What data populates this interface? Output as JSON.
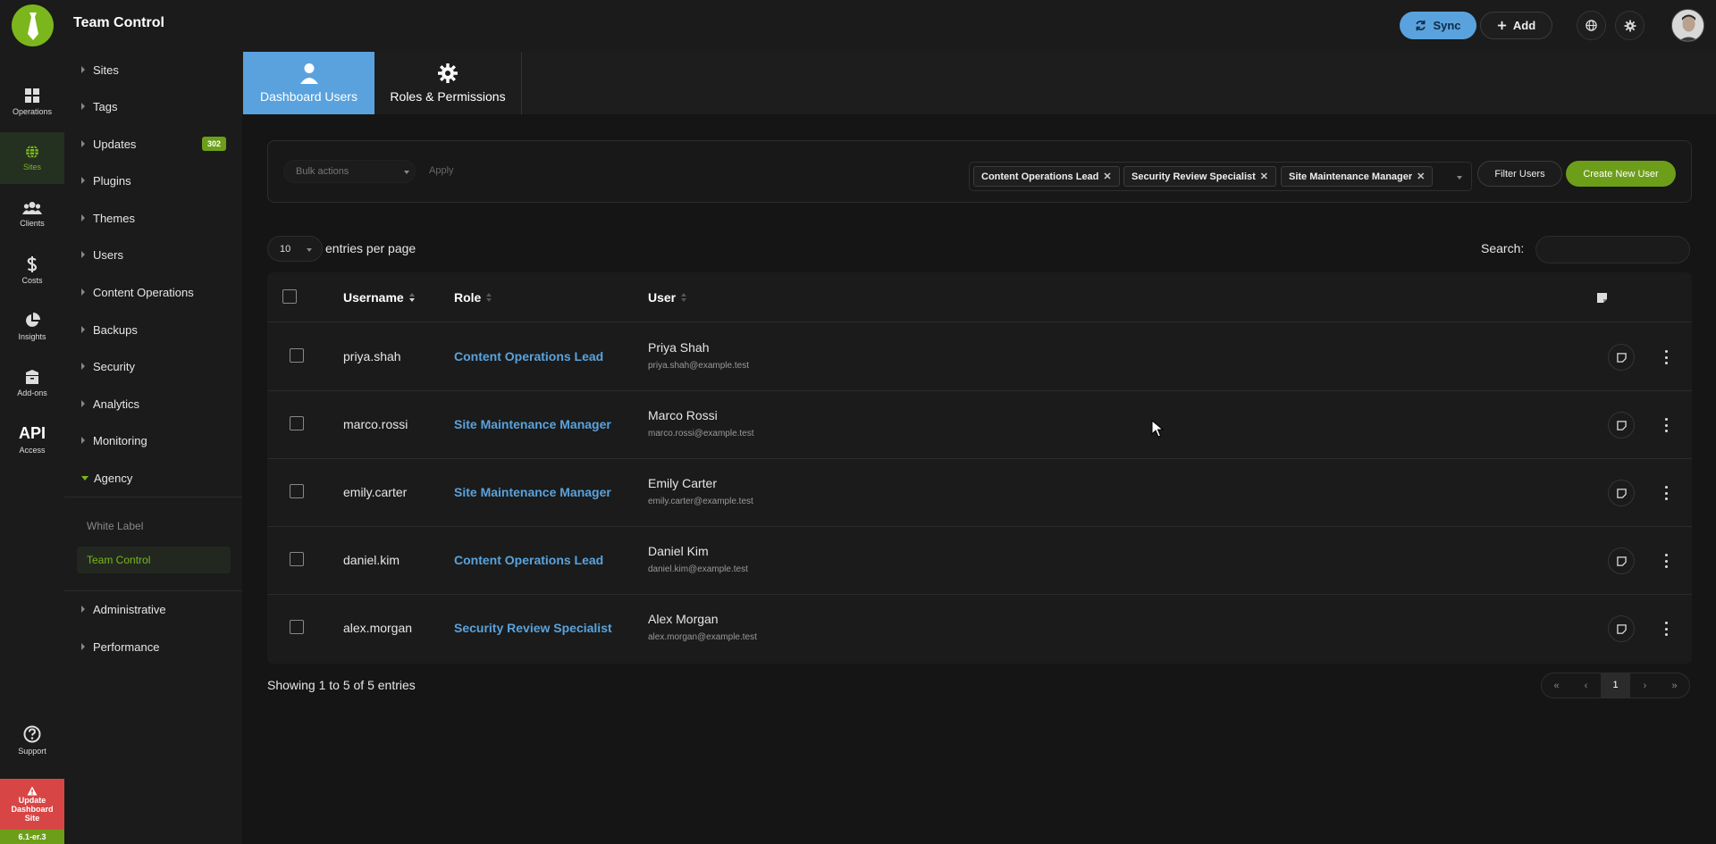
{
  "app": {
    "title": "Team Control"
  },
  "topbar": {
    "sync_label": "Sync",
    "add_label": "Add"
  },
  "rail": {
    "items": [
      {
        "label": "Operations",
        "icon": "grid-icon"
      },
      {
        "label": "Sites",
        "icon": "globe-icon"
      },
      {
        "label": "Clients",
        "icon": "users-icon"
      },
      {
        "label": "Costs",
        "icon": "dollar-icon"
      },
      {
        "label": "Insights",
        "icon": "pie-chart-icon"
      },
      {
        "label": "Add-ons",
        "icon": "box-icon"
      },
      {
        "label": "Access",
        "icon_text": "API"
      },
      {
        "label": "Support",
        "icon": "question-icon"
      }
    ],
    "update": {
      "line1": "Update",
      "line2": "Dashboard",
      "line3": "Site"
    },
    "version": "6.1-er.3"
  },
  "sidenav": {
    "items": [
      "Sites",
      "Tags",
      "Updates",
      "Plugins",
      "Themes",
      "Users",
      "Content Operations",
      "Backups",
      "Security",
      "Analytics",
      "Monitoring",
      "Agency",
      "Administrative",
      "Performance"
    ],
    "updates_badge": "302",
    "agency_sub": [
      "White Label",
      "Team Control"
    ]
  },
  "tabs": {
    "dashboard_users": "Dashboard Users",
    "roles_permissions": "Roles & Permissions"
  },
  "filterbar": {
    "bulk_placeholder": "Bulk actions",
    "apply_label": "Apply",
    "tags": [
      "Content Operations Lead",
      "Security Review Specialist",
      "Site Maintenance Manager"
    ],
    "filter_label": "Filter Users",
    "create_label": "Create New User"
  },
  "table_controls": {
    "page_size": "10",
    "entries_label": "entries per page",
    "search_label": "Search:"
  },
  "table": {
    "headers": {
      "username": "Username",
      "role": "Role",
      "user": "User"
    },
    "rows": [
      {
        "username": "priya.shah",
        "role": "Content Operations Lead",
        "name": "Priya Shah",
        "email": "priya.shah@example.test"
      },
      {
        "username": "marco.rossi",
        "role": "Site Maintenance Manager",
        "name": "Marco Rossi",
        "email": "marco.rossi@example.test"
      },
      {
        "username": "emily.carter",
        "role": "Site Maintenance Manager",
        "name": "Emily Carter",
        "email": "emily.carter@example.test"
      },
      {
        "username": "daniel.kim",
        "role": "Content Operations Lead",
        "name": "Daniel Kim",
        "email": "daniel.kim@example.test"
      },
      {
        "username": "alex.morgan",
        "role": "Security Review Specialist",
        "name": "Alex Morgan",
        "email": "alex.morgan@example.test"
      }
    ]
  },
  "footer": {
    "showing": "Showing 1 to 5 of 5 entries"
  },
  "pagination": {
    "first": "«",
    "prev": "‹",
    "current": "1",
    "next": "›",
    "last": "»"
  },
  "colors": {
    "accent_green": "#7cb61d",
    "accent_blue": "#5aa2dd",
    "danger": "#d84545",
    "bg": "#141514"
  }
}
